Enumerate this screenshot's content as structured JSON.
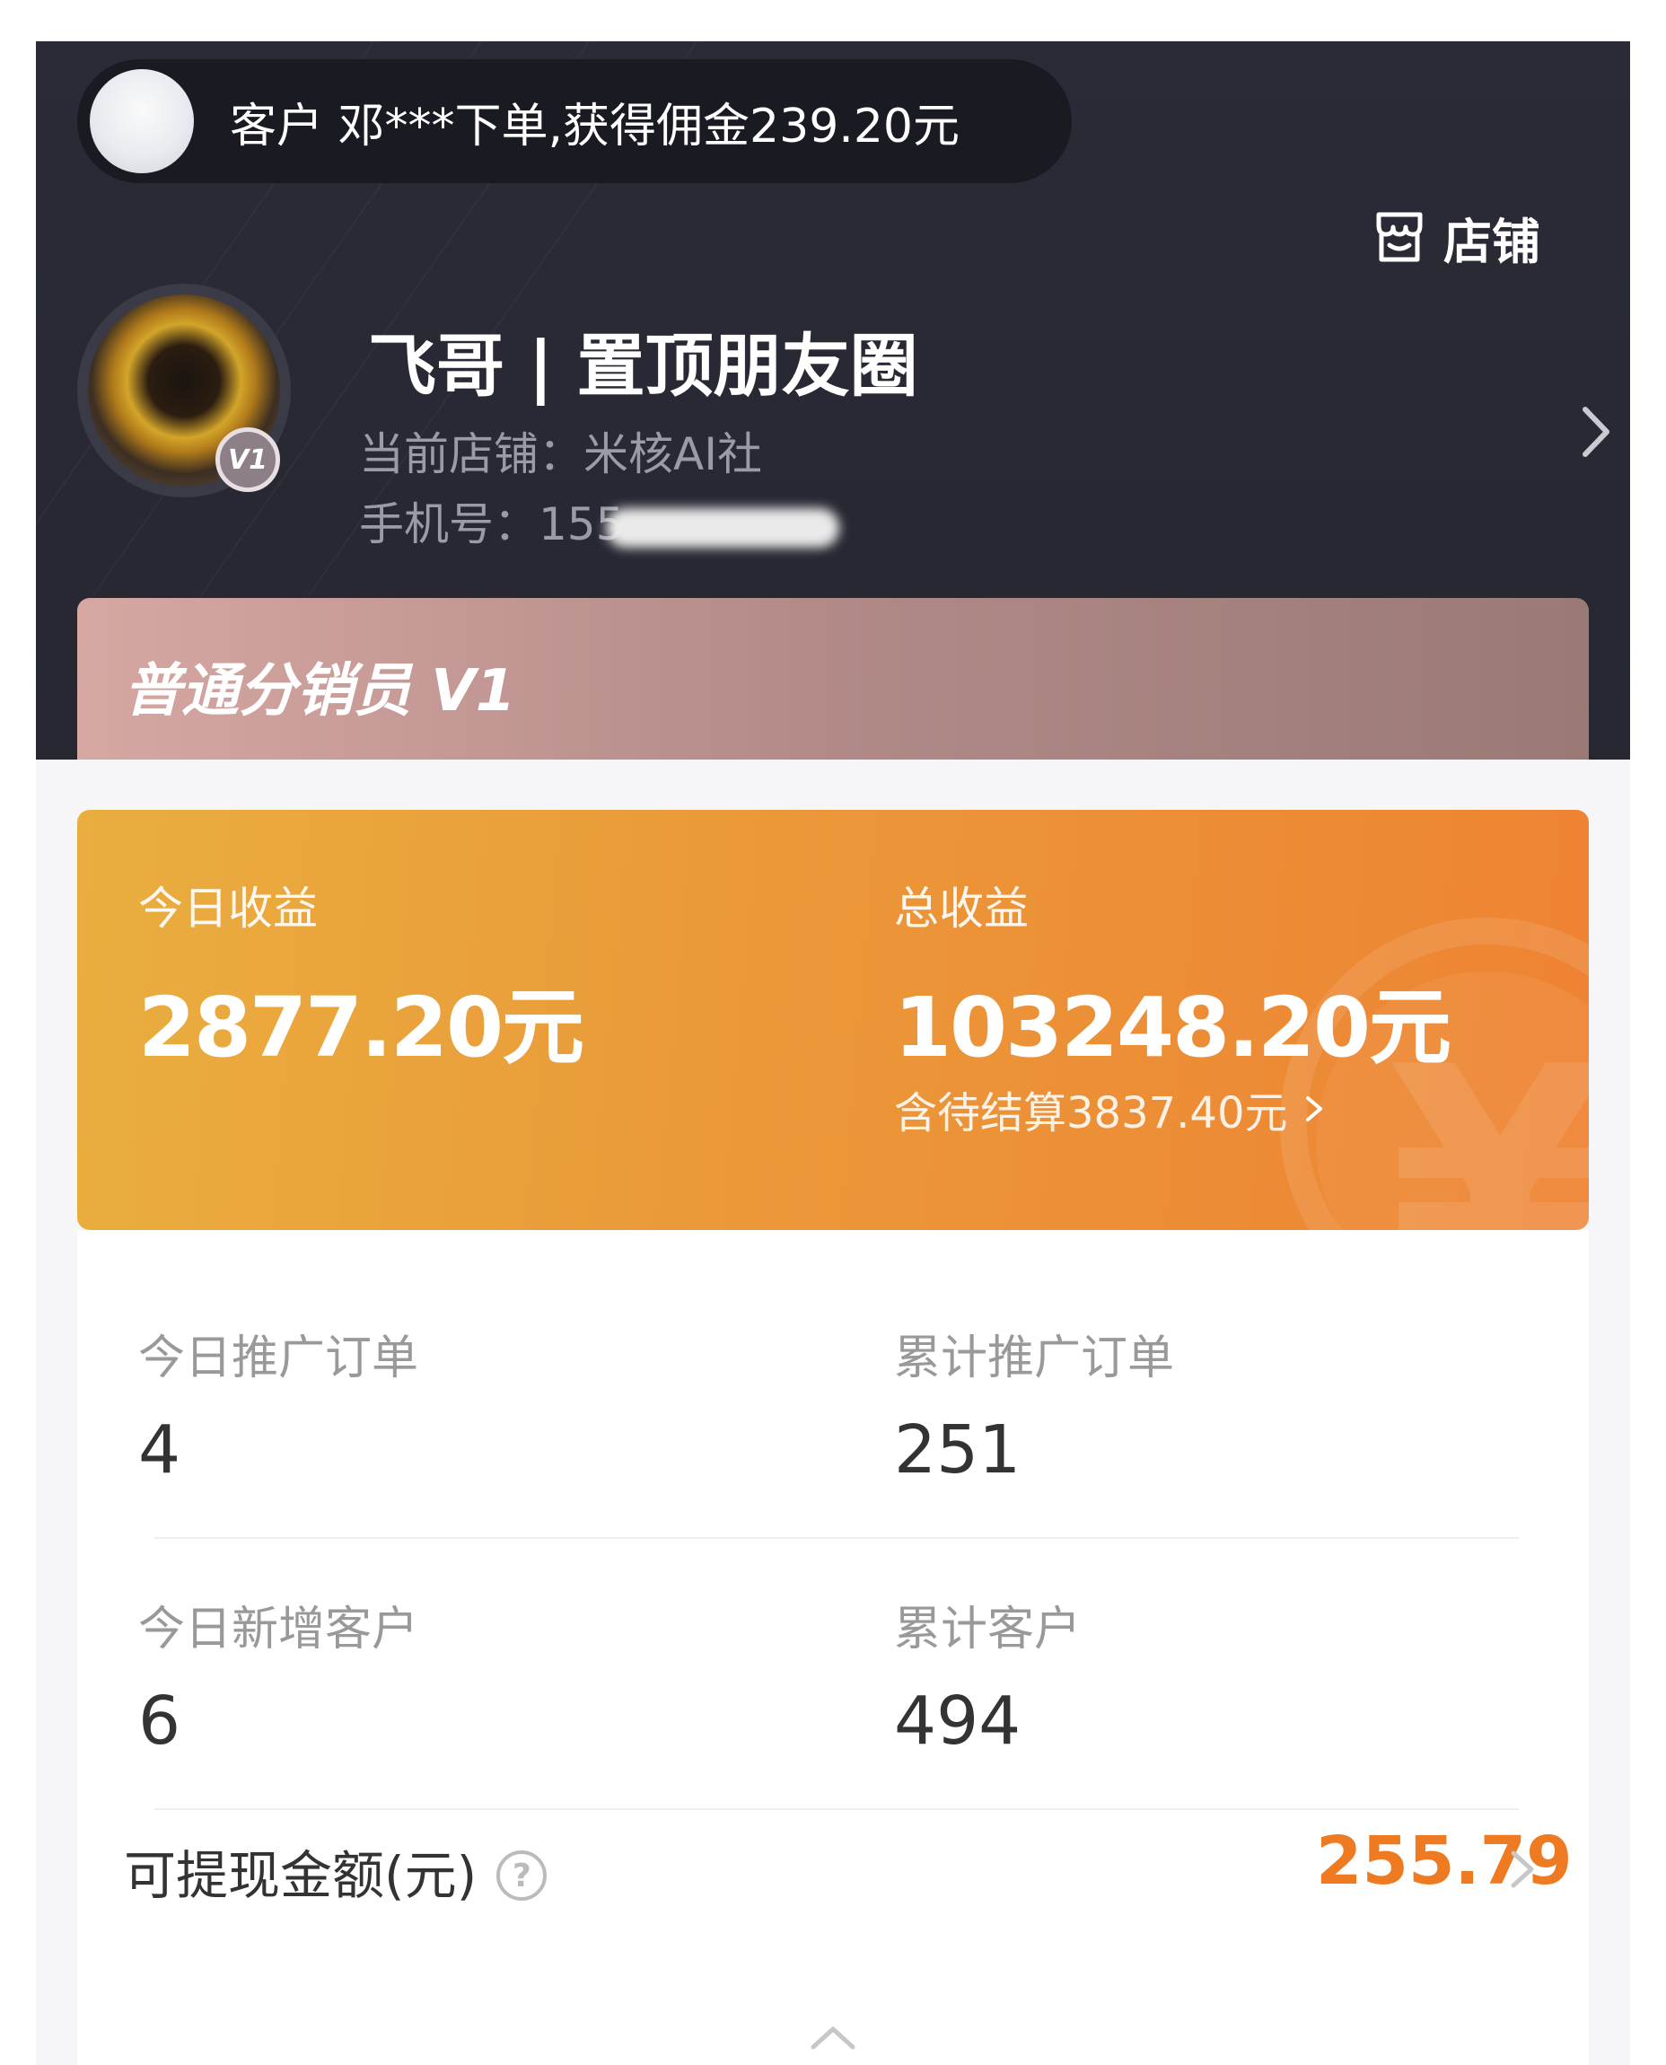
{
  "notice": {
    "text": "客户 邓***下单,获得佣金239.20元",
    "avatar_icon": "customer-avatar"
  },
  "store_link": {
    "label": "店铺",
    "icon": "store-icon"
  },
  "profile": {
    "nickname": "飞哥 | 置顶朋友圈",
    "shop_line": "当前店铺：米核AI社",
    "phone_label": "手机号：",
    "phone_visible": "155",
    "level_badge": "V1"
  },
  "level_card": {
    "title": "普通分销员 V1"
  },
  "earnings": {
    "today_label": "今日收益",
    "today_value": "2877.20元",
    "total_label": "总收益",
    "total_value": "103248.20元",
    "pending_text": "含待结算3837.40元"
  },
  "stats": {
    "today_orders_label": "今日推广订单",
    "today_orders_value": "4",
    "total_orders_label": "累计推广订单",
    "total_orders_value": "251",
    "today_customers_label": "今日新增客户",
    "today_customers_value": "6",
    "total_customers_label": "累计客户",
    "total_customers_value": "494"
  },
  "withdraw": {
    "label": "可提现金额(元)",
    "help": "?",
    "value": "255.79"
  },
  "colors": {
    "header_bg": "#282933",
    "accent_orange": "#ee7a22",
    "earn_gradient_start": "#e9ae3f",
    "earn_gradient_end": "#ee8333"
  }
}
